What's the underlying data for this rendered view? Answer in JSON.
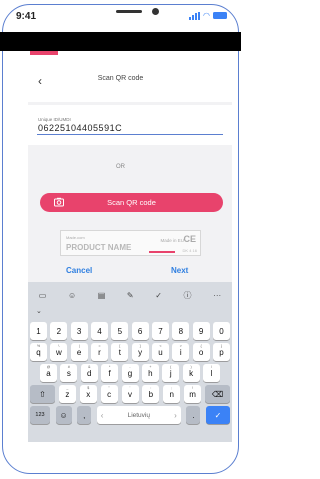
{
  "status": {
    "time": "9:41"
  },
  "header": {
    "back_icon": "chevron-left-icon",
    "title": "Scan QR code"
  },
  "form": {
    "field_label": "Unique ID/UMDI",
    "field_value": "06225104405591C"
  },
  "or_text": "OR",
  "scan_button": {
    "label": "Scan QR code",
    "icon": "camera-icon"
  },
  "product_sample": {
    "logo_text": "Made.com",
    "name": "PRODUCT NAME",
    "made_in": "Made in EU",
    "ce": "CE",
    "code": "DK 4 16"
  },
  "actions": {
    "cancel": "Cancel",
    "next": "Next"
  },
  "keyboard": {
    "suggestions": [
      "▭",
      "☺",
      "▤",
      "✎",
      "✓",
      "ⓘ",
      "···"
    ],
    "row1": [
      {
        "main": "1",
        "sub": ""
      },
      {
        "main": "2",
        "sub": ""
      },
      {
        "main": "3",
        "sub": ""
      },
      {
        "main": "4",
        "sub": ""
      },
      {
        "main": "5",
        "sub": ""
      },
      {
        "main": "6",
        "sub": ""
      },
      {
        "main": "7",
        "sub": ""
      },
      {
        "main": "8",
        "sub": ""
      },
      {
        "main": "9",
        "sub": ""
      },
      {
        "main": "0",
        "sub": ""
      }
    ],
    "row2": [
      {
        "main": "q",
        "sub": "%"
      },
      {
        "main": "w",
        "sub": "\\"
      },
      {
        "main": "e",
        "sub": "|"
      },
      {
        "main": "r",
        "sub": "="
      },
      {
        "main": "t",
        "sub": "["
      },
      {
        "main": "y",
        "sub": "]"
      },
      {
        "main": "u",
        "sub": "<"
      },
      {
        "main": "i",
        "sub": ">"
      },
      {
        "main": "o",
        "sub": "{"
      },
      {
        "main": "p",
        "sub": "}"
      }
    ],
    "row3": [
      {
        "main": "a",
        "sub": "@"
      },
      {
        "main": "s",
        "sub": "#"
      },
      {
        "main": "d",
        "sub": "&"
      },
      {
        "main": "f",
        "sub": "*"
      },
      {
        "main": "g",
        "sub": "-"
      },
      {
        "main": "h",
        "sub": "+"
      },
      {
        "main": "j",
        "sub": "("
      },
      {
        "main": "k",
        "sub": ")"
      },
      {
        "main": "l",
        "sub": "/"
      }
    ],
    "row4": [
      {
        "main": "z",
        "sub": "_"
      },
      {
        "main": "x",
        "sub": "$"
      },
      {
        "main": "c",
        "sub": "\""
      },
      {
        "main": "v",
        "sub": "'"
      },
      {
        "main": "b",
        "sub": ":"
      },
      {
        "main": "n",
        "sub": ";"
      },
      {
        "main": "m",
        "sub": "!"
      }
    ],
    "shift_label": "⇧",
    "backspace_label": "⌫",
    "numbers_label": "123",
    "emoji_label": "☺",
    "comma_label": ",",
    "space_label": "Lietuvių",
    "left_arrow": "‹",
    "right_arrow": "›",
    "period_label": ".",
    "enter_label": "✓"
  }
}
